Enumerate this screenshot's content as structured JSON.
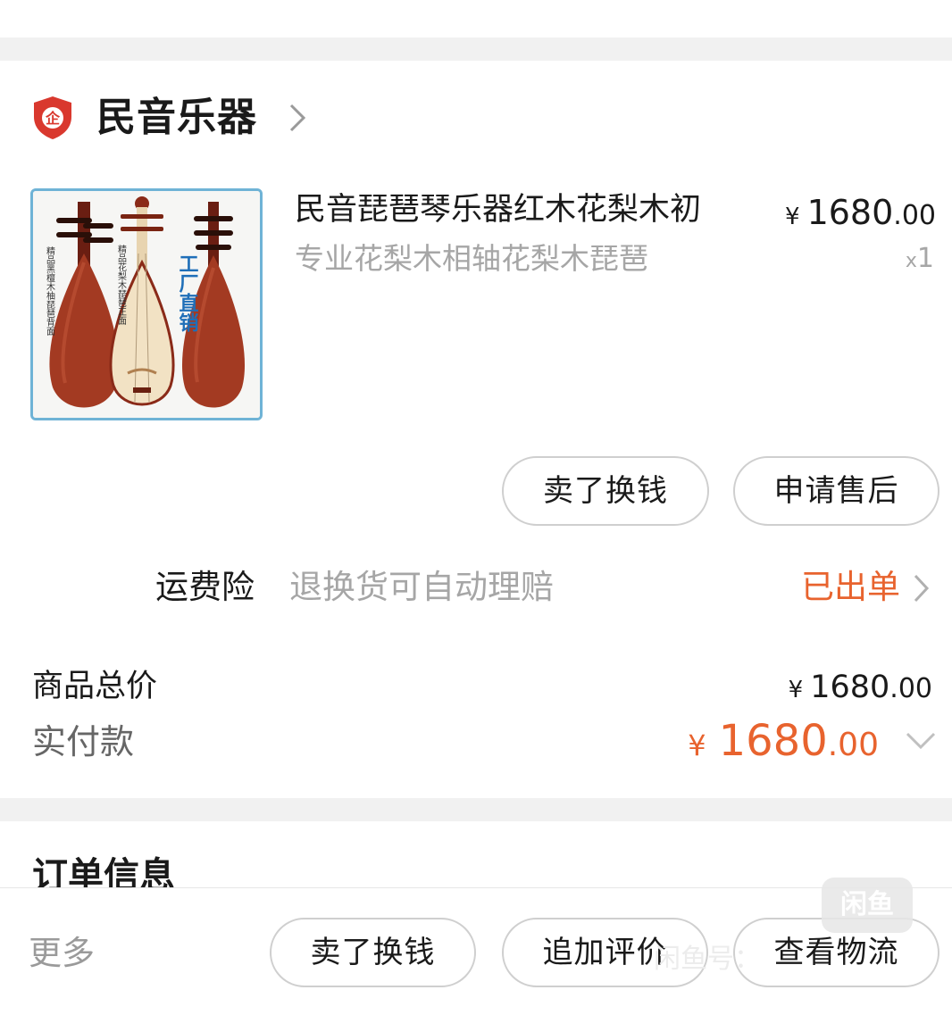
{
  "shop": {
    "name": "民音乐器"
  },
  "product": {
    "title": "民音琵琶琴乐器红木花梨木初",
    "spec": "专业花梨木相轴花梨木琵琶",
    "price": {
      "currency": "¥",
      "integer": "1680",
      "decimal": ".00"
    },
    "quantity": {
      "prefix": "x",
      "value": "1"
    },
    "image": {
      "badge_text": "工厂直销",
      "side_labels": [
        "精品黑檀木柚琵琶背面",
        "精品花梨木琵琶正面"
      ]
    }
  },
  "item_actions": {
    "sell_label": "卖了换钱",
    "aftersale_label": "申请售后"
  },
  "insurance": {
    "label": "运费险",
    "description": "退换货可自动理赔",
    "status": "已出单"
  },
  "totals": {
    "goods_label": "商品总价",
    "goods_value": {
      "currency": "¥",
      "integer": "1680",
      "decimal": ".00"
    },
    "paid_label": "实付款",
    "paid_value": {
      "currency": "¥",
      "integer": "1680",
      "decimal": ".00"
    }
  },
  "order_info": {
    "title": "订单信息"
  },
  "bottom_bar": {
    "more_label": "更多",
    "buttons": [
      "卖了换钱",
      "追加评价",
      "查看物流"
    ]
  },
  "watermark": {
    "logo_text": "闲鱼",
    "text": "闲鱼号："
  },
  "colors": {
    "accent": "#e8632e",
    "muted": "#a6a6a6",
    "divider": "#f1f1f1"
  }
}
